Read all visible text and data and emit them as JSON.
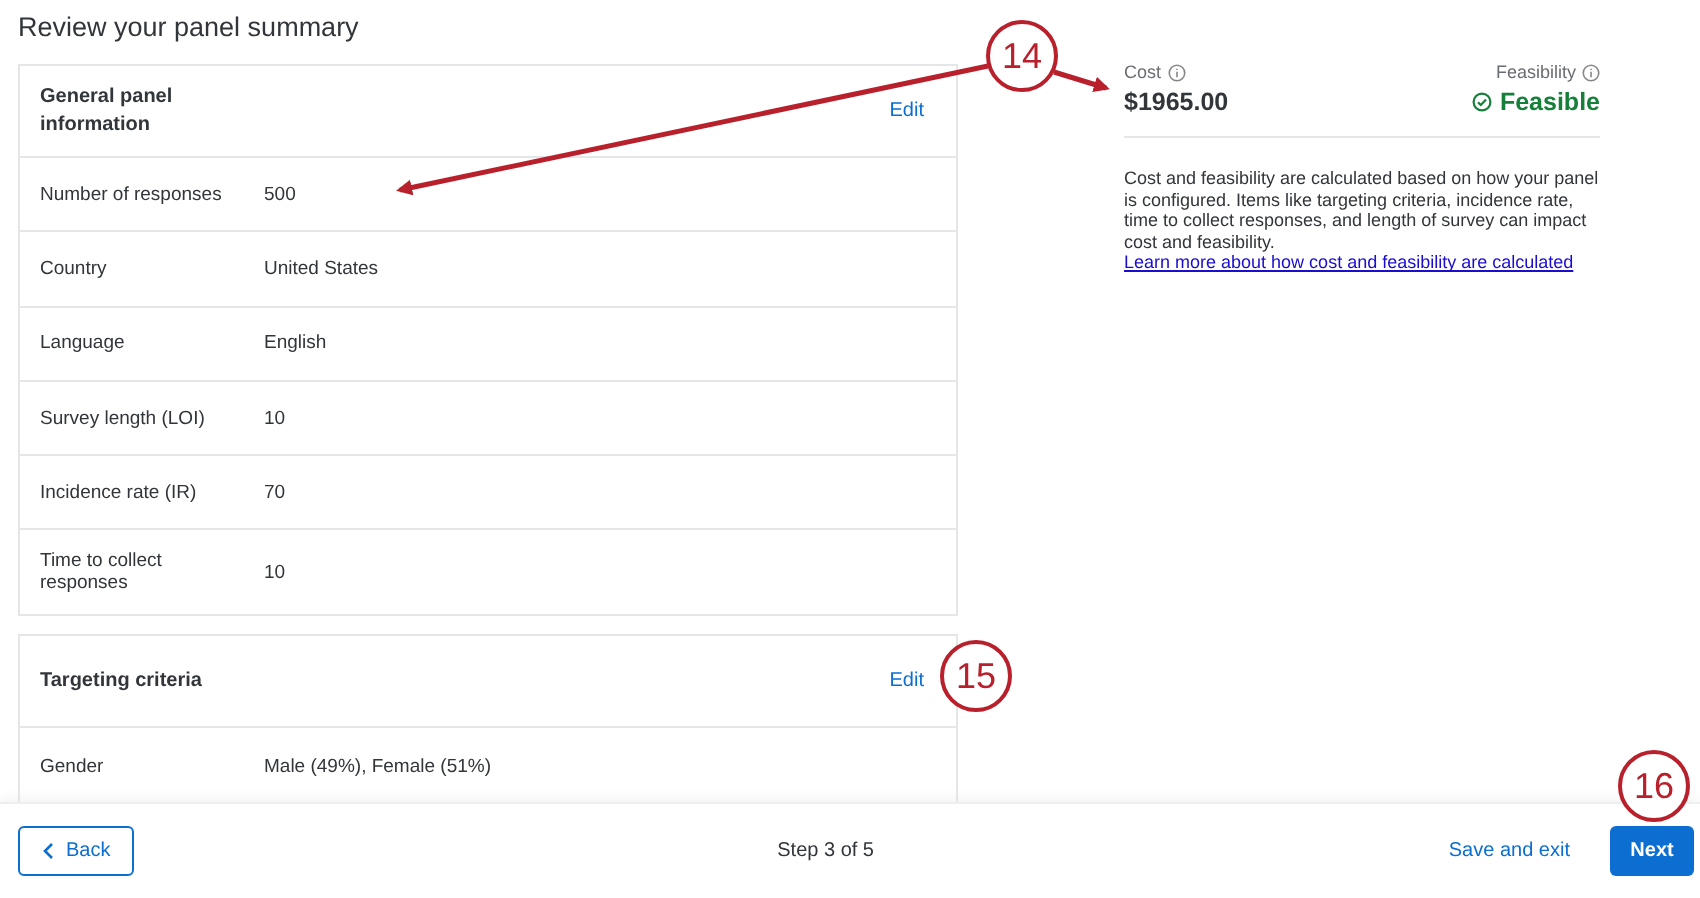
{
  "page_title": "Review your panel summary",
  "sections": [
    {
      "title": "General panel information",
      "action": "Edit",
      "rows": [
        {
          "label": "Number of responses",
          "value": "500"
        },
        {
          "label": "Country",
          "value": "United States"
        },
        {
          "label": "Language",
          "value": "English"
        },
        {
          "label": "Survey length (LOI)",
          "value": "10"
        },
        {
          "label": "Incidence rate (IR)",
          "value": "70"
        },
        {
          "label": "Time to collect responses",
          "value": "10"
        }
      ]
    },
    {
      "title": "Targeting criteria",
      "action": "Edit",
      "rows": [
        {
          "label": "Gender",
          "value": "Male (49%), Female (51%)"
        }
      ]
    }
  ],
  "summary": {
    "cost_label": "Cost",
    "cost": "$1965.00",
    "feasibility_label": "Feasibility",
    "feasibility": "Feasible",
    "feasible": true,
    "description": "Cost and feasibility are calculated based on how your panel is configured. Items like targeting criteria, incidence rate, time to collect responses, and length of survey can impact cost and feasibility.",
    "link": "Learn more about how cost and feasibility are calculated"
  },
  "footer": {
    "back": "Back",
    "step": "Step 3 of 5",
    "save": "Save and exit",
    "next": "Next"
  },
  "callouts": [
    "14",
    "15",
    "16"
  ]
}
